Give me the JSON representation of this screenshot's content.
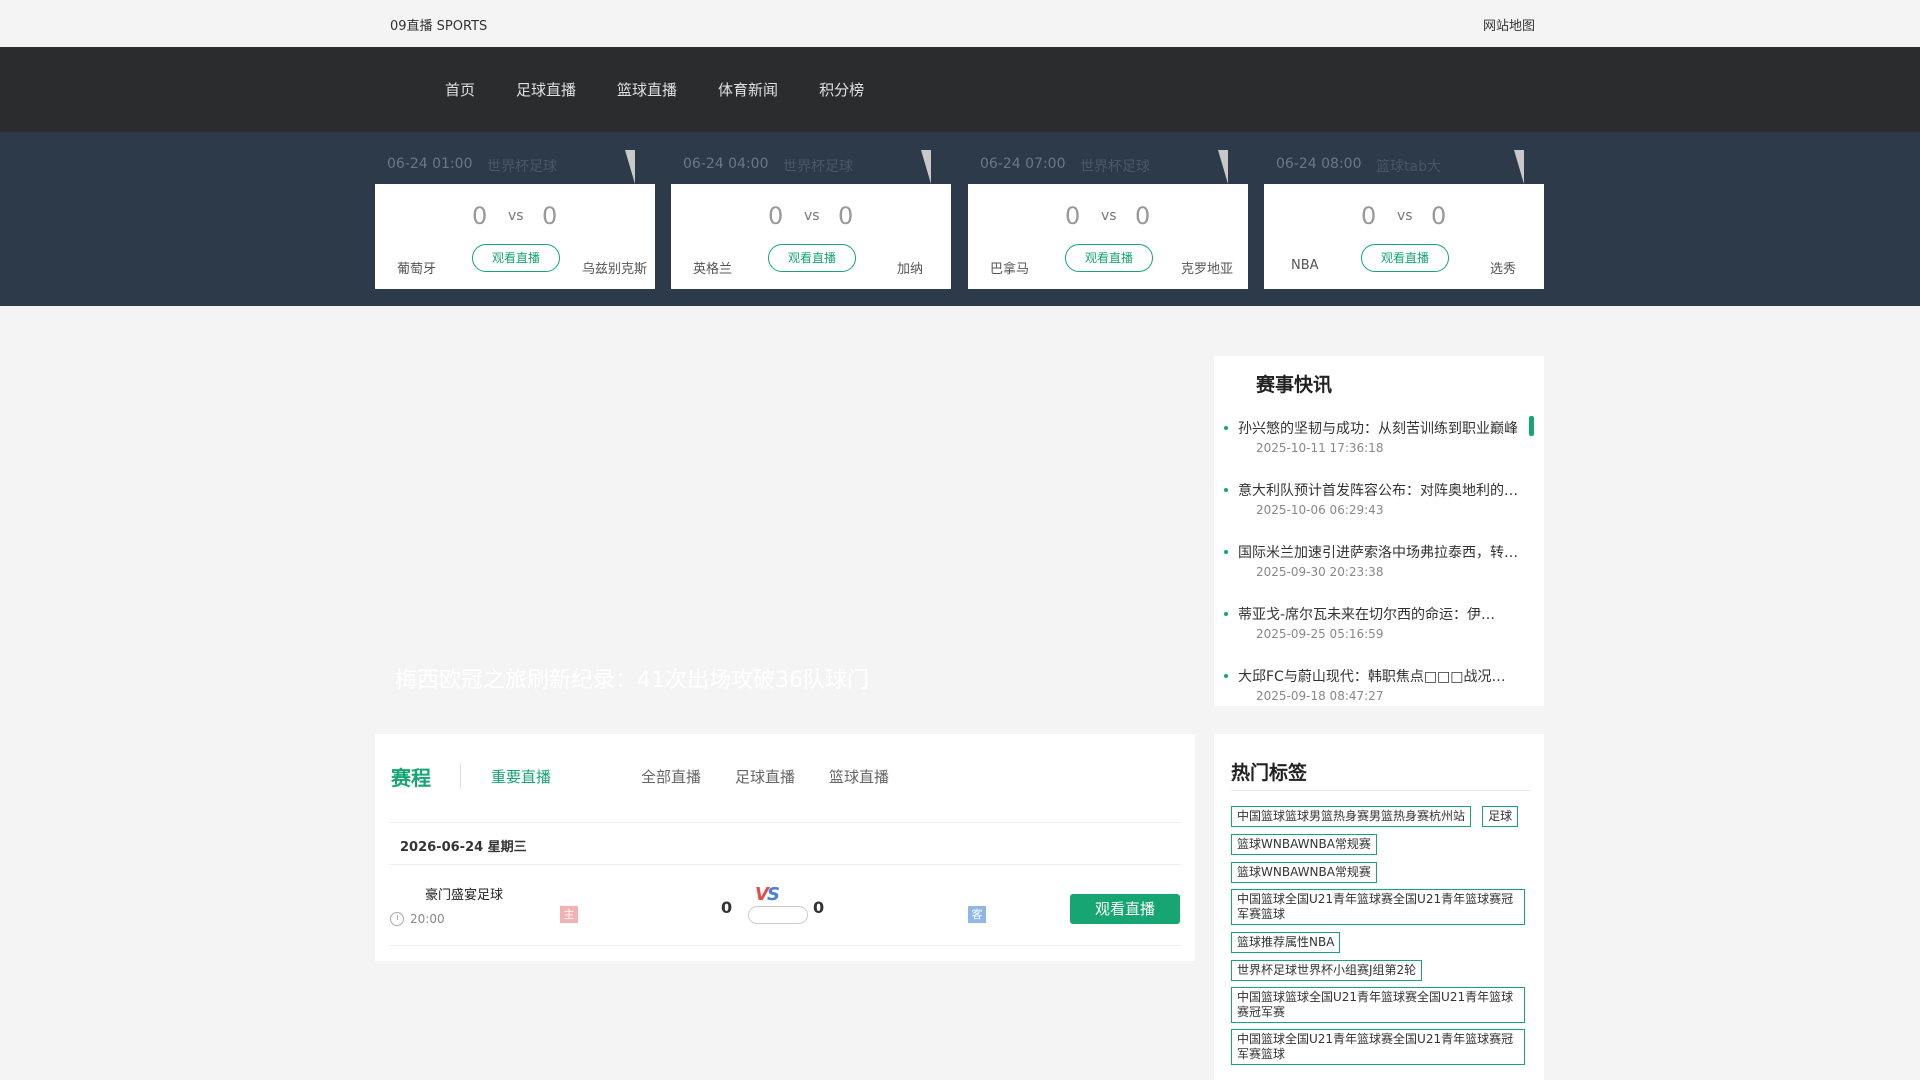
{
  "topbar": {
    "brand": "09直播 SPORTS",
    "sitemap": "网站地图"
  },
  "nav": {
    "items": [
      "首页",
      "足球直播",
      "篮球直播",
      "体育新闻",
      "积分榜"
    ]
  },
  "matches": [
    {
      "time": "06-24 01:00",
      "league": "世界杯足球",
      "home": "葡萄牙",
      "away": "乌兹别克斯",
      "home_score": "0",
      "away_score": "0",
      "vs": "vs",
      "watch": "观看直播"
    },
    {
      "time": "06-24 04:00",
      "league": "世界杯足球",
      "home": "英格兰",
      "away": "加纳",
      "home_score": "0",
      "away_score": "0",
      "vs": "vs",
      "watch": "观看直播"
    },
    {
      "time": "06-24 07:00",
      "league": "世界杯足球",
      "home": "巴拿马",
      "away": "克罗地亚",
      "home_score": "0",
      "away_score": "0",
      "vs": "vs",
      "watch": "观看直播"
    },
    {
      "time": "06-24 08:00",
      "league": "篮球tab大",
      "home": "NBA",
      "away": "选秀",
      "home_score": "0",
      "away_score": "0",
      "vs": "vs",
      "watch": "观看直播"
    }
  ],
  "banner": {
    "caption": "梅西欧冠之旅刷新纪录：41次出场攻破36队球门"
  },
  "news": {
    "title": "赛事快讯",
    "items": [
      {
        "title": "孙兴慜的坚韧与成功：从刻苦训练到职业巅峰",
        "date": "2025-10-11 17:36:18"
      },
      {
        "title": "意大利队预计首发阵容公布：对阵奥地利的关键一战",
        "date": "2025-10-06 06:29:43"
      },
      {
        "title": "国际米兰加速引进萨索洛中场弗拉泰西，转会进展",
        "date": "2025-09-30 20:23:38"
      },
      {
        "title": "蒂亚戈-席尔瓦未来在切尔西的命运：伊…",
        "date": "2025-09-25 05:16:59"
      },
      {
        "title": "大邱FC与蔚山现代：韩职焦点□□□战况…",
        "date": "2025-09-18 08:47:27"
      }
    ]
  },
  "schedule": {
    "title": "赛程",
    "tabs": [
      "重要直播",
      "全部直播",
      "足球直播",
      "篮球直播"
    ],
    "date_row": "2026-06-24 星期三",
    "game": {
      "league": "豪门盛宴足球",
      "time": "20:00",
      "home_tag": "主",
      "away_tag": "客",
      "home_score": "0",
      "away_score": "0",
      "vs_left": "V",
      "vs_right": "S",
      "watch": "观看直播"
    }
  },
  "tags": {
    "title": "热门标签",
    "items": [
      "中国篮球篮球男篮热身赛男篮热身赛杭州站",
      "足球",
      "篮球WNBAWNBA常规赛",
      "篮球WNBAWNBA常规赛",
      "中国篮球全国U21青年篮球赛全国U21青年篮球赛冠军赛篮球",
      "篮球推荐属性NBA",
      "世界杯足球世界杯小组赛J组第2轮",
      "中国篮球篮球全国U21青年篮球赛全国U21青年篮球赛冠军赛",
      "中国篮球全国U21青年篮球赛全国U21青年篮球赛冠军赛篮球"
    ]
  },
  "colors": {
    "accent": "#17a673",
    "nav_bg": "#2a2c2e",
    "band_bg": "#2c3a4a"
  }
}
